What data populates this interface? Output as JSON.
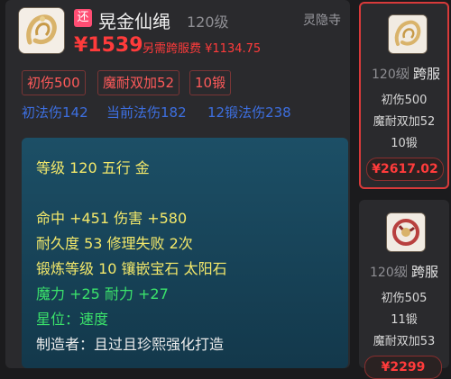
{
  "main": {
    "badge": "还",
    "name": "晃金仙绳",
    "level": "120级",
    "server": "灵隐寺",
    "price": "¥1539",
    "cross_fee": "另需跨服费 ¥1134.75",
    "tags": [
      "初伤500",
      "魔耐双加52",
      "10锻"
    ],
    "tags2": [
      "初法伤142",
      "当前法伤182",
      "12锻法伤238"
    ],
    "details": [
      {
        "text": "等级 120 五行 金",
        "color": "yellow"
      },
      {
        "text": "命中 +451 伤害 +580",
        "color": "yellow"
      },
      {
        "text": "耐久度 53 修理失败 2次",
        "color": "yellow"
      },
      {
        "text": "锻炼等级 10 镶嵌宝石 太阳石",
        "color": "yellow"
      },
      {
        "text": "魔力 +25 耐力 +27",
        "color": "green"
      },
      {
        "text": "星位：速度",
        "color": "green"
      },
      {
        "text": "制造者：且过且珍熙强化打造",
        "color": "white"
      }
    ]
  },
  "side": [
    {
      "level": "120级",
      "cross": "跨服",
      "lines": [
        "初伤500",
        "魔耐双加52",
        "10锻"
      ],
      "price": "¥2617.02",
      "selected": true
    },
    {
      "level": "120级",
      "cross": "跨服",
      "lines": [
        "初伤505",
        "11锻",
        "魔耐双加53"
      ],
      "price": "¥2299",
      "selected": false
    }
  ],
  "colors": {
    "price": "#ff3b3b",
    "accent_border": "#d83a3a",
    "green": "#3be26b",
    "yellow": "#f3e86a"
  }
}
